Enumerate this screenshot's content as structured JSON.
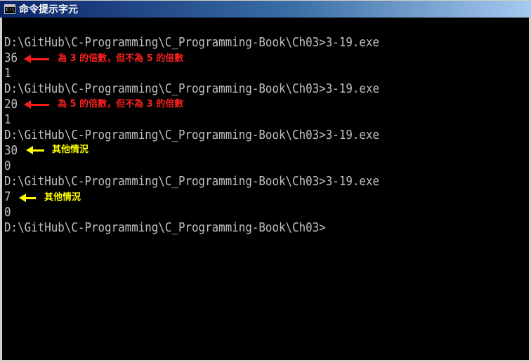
{
  "window": {
    "title": "命令提示字元",
    "icon": "console-window-icon",
    "icon_glyph": "C:\\"
  },
  "console": {
    "text_color": "#c0c0c0",
    "background": "#000000",
    "lines": [
      "",
      "D:\\GitHub\\C-Programming\\C_Programming-Book\\Ch03>3-19.exe",
      "36",
      "1",
      "D:\\GitHub\\C-Programming\\C_Programming-Book\\Ch03>3-19.exe",
      "20",
      "1",
      "D:\\GitHub\\C-Programming\\C_Programming-Book\\Ch03>3-19.exe",
      "30",
      "0",
      "D:\\GitHub\\C-Programming\\C_Programming-Book\\Ch03>3-19.exe",
      "7",
      "0",
      "D:\\GitHub\\C-Programming\\C_Programming-Book\\Ch03>"
    ]
  },
  "annotations": [
    {
      "text": "為 3 的倍數，但不為 5 的倍數",
      "color": "red",
      "hex": "#ff2020",
      "arrow_icon": "left-arrow-icon"
    },
    {
      "text": "為 5 的倍數，但不為 3 的倍數",
      "color": "red",
      "hex": "#ff2020",
      "arrow_icon": "left-arrow-icon"
    },
    {
      "text": "其他情況",
      "color": "yellow",
      "hex": "#ffff00",
      "arrow_icon": "left-arrow-icon"
    },
    {
      "text": "其他情況",
      "color": "yellow",
      "hex": "#ffff00",
      "arrow_icon": "left-arrow-icon"
    }
  ]
}
